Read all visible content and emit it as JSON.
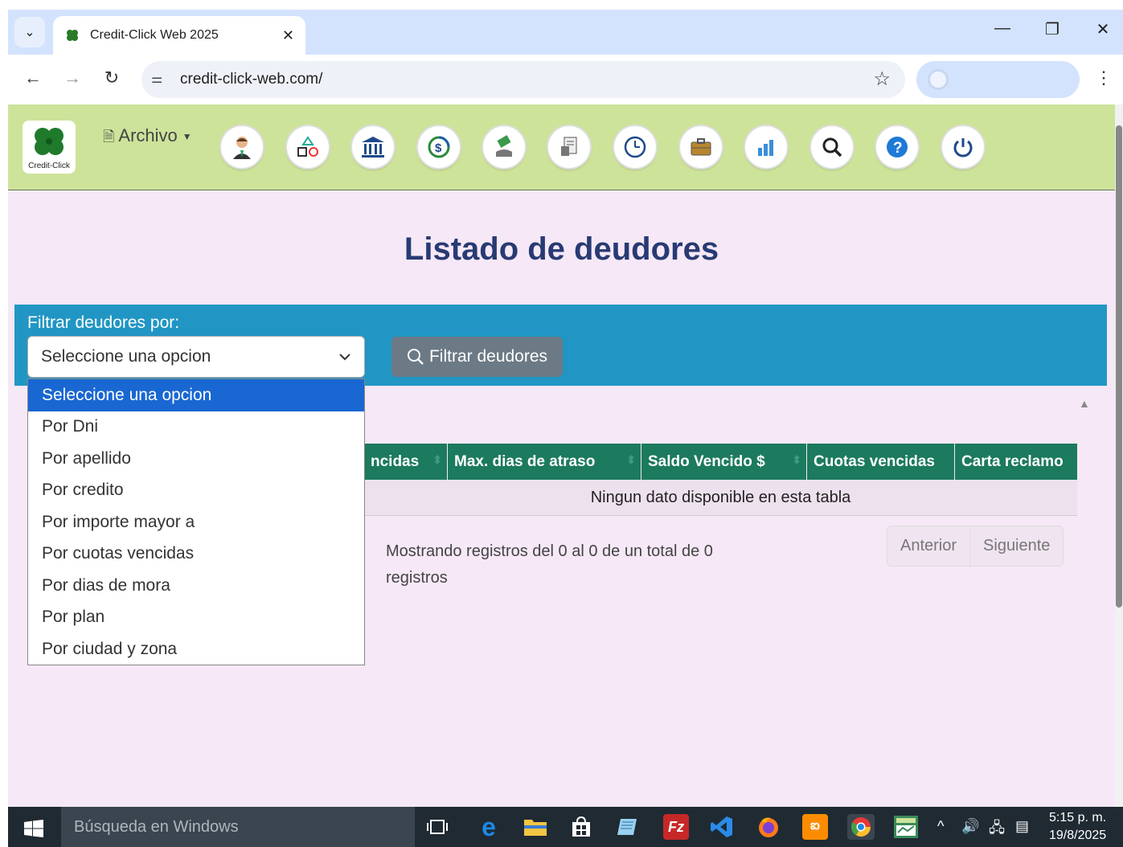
{
  "browser": {
    "tab_title": "Credit-Click Web 2025",
    "url": "credit-click-web.com/"
  },
  "app": {
    "logo_caption": "Credit-Click",
    "archivo_label": "Archivo",
    "icons": [
      "user-icon",
      "shapes-icon",
      "bank-icon",
      "money-cycle-icon",
      "hand-money-icon",
      "document-icon",
      "clock-icon",
      "briefcase-icon",
      "bar-chart-icon",
      "search-icon",
      "help-icon",
      "power-icon"
    ]
  },
  "page": {
    "title": "Listado de deudores",
    "filter_label": "Filtrar deudores por:",
    "select_value": "Seleccione una opcion",
    "filter_button": "Filtrar deudores",
    "options": [
      "Seleccione una opcion",
      "Por Dni",
      "Por apellido",
      "Por credito",
      "Por importe mayor a",
      "Por cuotas vencidas",
      "Por dias de mora",
      "Por plan",
      "Por ciudad y zona"
    ],
    "table_headers": [
      "ncidas",
      "Max. dias de atraso",
      "Saldo Vencido $",
      "Cuotas vencidas",
      "Carta reclamo"
    ],
    "empty_message": "Ningun dato disponible en esta tabla",
    "info": "Mostrando registros del 0 al 0 de un total de 0 registros",
    "prev": "Anterior",
    "next": "Siguiente"
  },
  "taskbar": {
    "search_placeholder": "Búsqueda en Windows",
    "time": "5:15 p. m.",
    "date": "19/8/2025"
  }
}
